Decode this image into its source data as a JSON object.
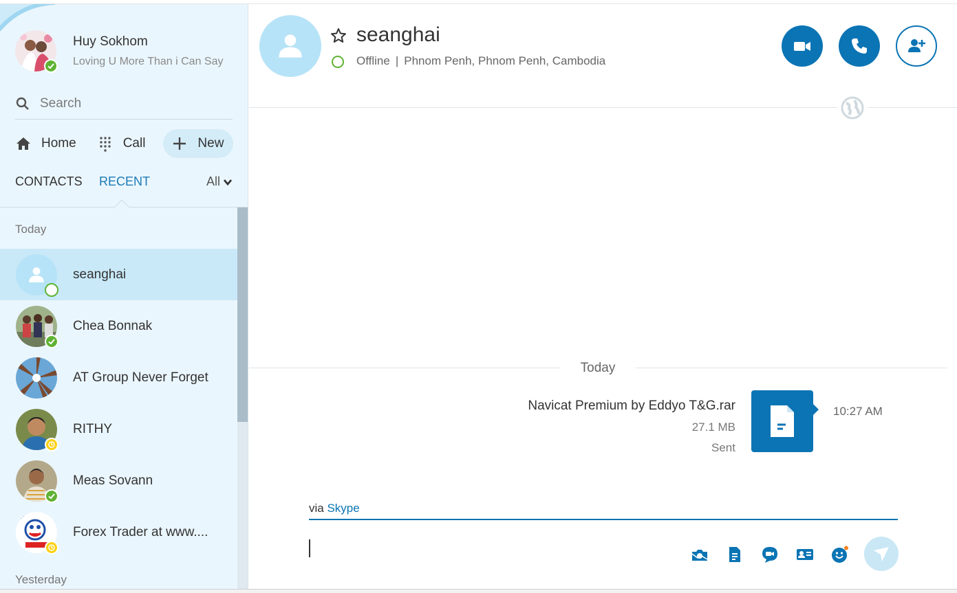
{
  "profile": {
    "name": "Huy Sokhom",
    "mood": "Loving U More Than i Can Say",
    "status": "online"
  },
  "search": {
    "placeholder": "Search"
  },
  "nav": {
    "home": "Home",
    "call": "Call",
    "new": "New"
  },
  "tabs": {
    "contacts": "CONTACTS",
    "recent": "RECENT",
    "filter": "All",
    "active": "RECENT"
  },
  "sections": {
    "today": "Today",
    "yesterday": "Yesterday"
  },
  "contacts": [
    {
      "name": "seanghai",
      "status": "offline",
      "active": true
    },
    {
      "name": "Chea Bonnak",
      "status": "online",
      "active": false
    },
    {
      "name": "AT Group Never Forget",
      "status": "none",
      "active": false
    },
    {
      "name": "RITHY",
      "status": "away",
      "active": false
    },
    {
      "name": "Meas Sovann",
      "status": "online",
      "active": false
    },
    {
      "name": "Forex Trader  at www....",
      "status": "away",
      "active": false
    }
  ],
  "conversation": {
    "name": "seanghai",
    "status": "Offline",
    "separator": "|",
    "location": "Phnom Penh, Phnom Penh, Cambodia",
    "day_label": "Today",
    "message": {
      "file_name": "Navicat Premium by Eddyo T&G.rar",
      "file_size": "27.1 MB",
      "state": "Sent",
      "time": "10:27 AM"
    },
    "via_prefix": "via",
    "via_link": "Skype"
  },
  "colors": {
    "accent": "#0b74b4",
    "sidebar_bg": "#eaf6fd",
    "active_row": "#c9e9f8",
    "online": "#5fb334",
    "away": "#fcd116"
  },
  "icons": {
    "header": [
      "video-icon",
      "phone-icon",
      "add-contact-icon"
    ],
    "compose": [
      "media-icon",
      "file-icon",
      "video-message-icon",
      "contact-card-icon",
      "emoticon-icon",
      "send-icon"
    ]
  }
}
